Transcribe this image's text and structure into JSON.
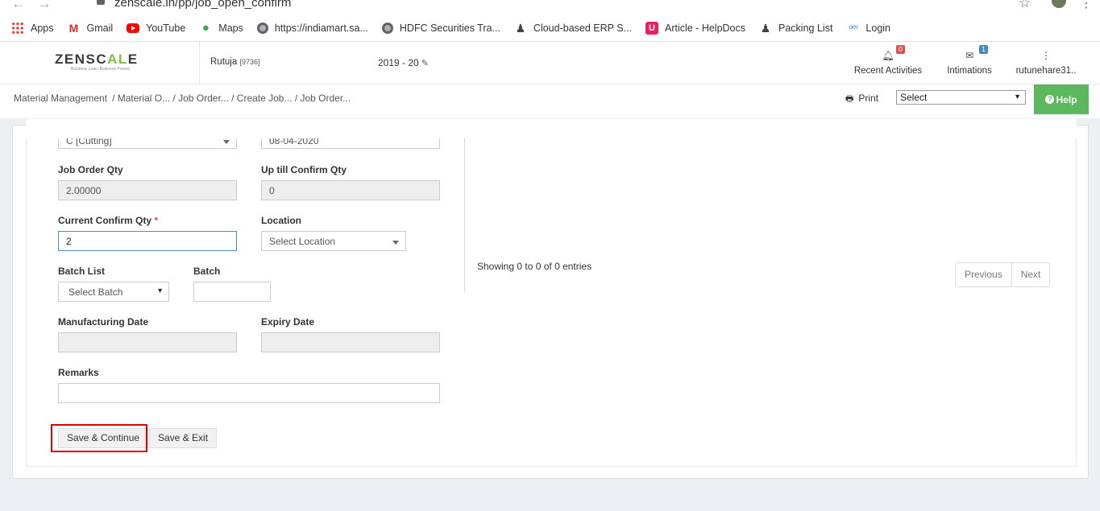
{
  "browser": {
    "url": "zenscale.in/pp/job_open_confirm",
    "bookmarks": [
      {
        "label": "Apps",
        "icon": "apps-grid-icon"
      },
      {
        "label": "Gmail",
        "icon": "gmail-icon"
      },
      {
        "label": "YouTube",
        "icon": "youtube-icon"
      },
      {
        "label": "Maps",
        "icon": "maps-pin-icon"
      },
      {
        "label": "https://indiamart.sa...",
        "icon": "globe-icon"
      },
      {
        "label": "HDFC Securities Tra...",
        "icon": "globe-icon"
      },
      {
        "label": "Cloud-based ERP S...",
        "icon": "person-icon"
      },
      {
        "label": "Article - HelpDocs",
        "icon": "helpdocs-icon"
      },
      {
        "label": "Packing List",
        "icon": "person-icon"
      },
      {
        "label": "Login",
        "icon": "login-icon"
      }
    ]
  },
  "header": {
    "logo_left": "ZENSC",
    "logo_accent": "AL",
    "logo_right": "E",
    "logo_tagline": "Business Lean. Business Proven.",
    "user": "Rutuja",
    "user_code": "[9736]",
    "fiscal_year": "2019 - 20",
    "recent_activities_label": "Recent Activities",
    "recent_activities_count": "0",
    "intimations_label": "Intimations",
    "intimations_count": "1",
    "profile_label": "rutunehare31.."
  },
  "subheader": {
    "breadcrumb_root": "Material Management",
    "breadcrumb_rest": "/ Material O... / Job Order... / Create Job... / Job Order...",
    "print_label": "Print",
    "select_value": "Select",
    "help_label": "Help"
  },
  "form": {
    "process_value": "C [Cutting]",
    "date_value": "08-04-2020",
    "job_order_qty_label": "Job Order Qty",
    "job_order_qty_value": "2.00000",
    "up_till_confirm_qty_label": "Up till Confirm Qty",
    "up_till_confirm_qty_value": "0",
    "current_confirm_qty_label": "Current Confirm Qty",
    "required_marker": "*",
    "current_confirm_qty_value": "2",
    "location_label": "Location",
    "location_value": "Select Location",
    "batch_list_label": "Batch List",
    "batch_list_value": "Select Batch",
    "batch_label": "Batch",
    "batch_value": "",
    "manufacturing_date_label": "Manufacturing Date",
    "manufacturing_date_value": "",
    "expiry_date_label": "Expiry Date",
    "expiry_date_value": "",
    "remarks_label": "Remarks",
    "remarks_value": ""
  },
  "table": {
    "entries_info": "Showing 0 to 0 of 0 entries",
    "previous_label": "Previous",
    "next_label": "Next"
  },
  "actions": {
    "save_continue_label": "Save & Continue",
    "save_exit_label": "Save & Exit"
  },
  "colors": {
    "help_green": "#5cb85c",
    "logo_accent": "#7ac143",
    "highlight_red": "#e10000",
    "required_red": "#d9534f"
  }
}
